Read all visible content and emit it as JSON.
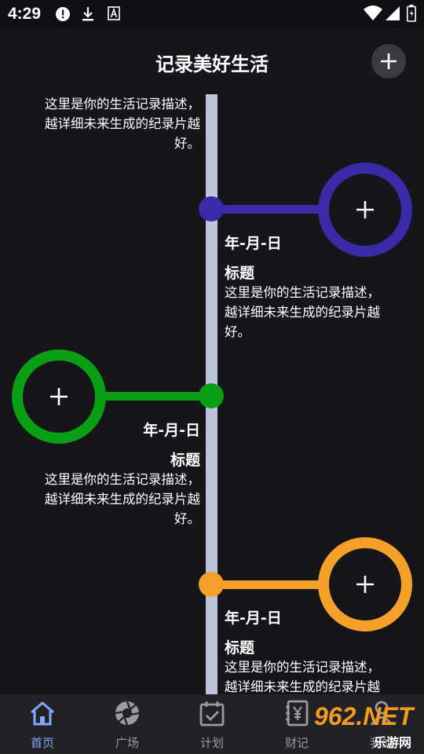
{
  "status": {
    "time": "4:29"
  },
  "header": {
    "title": "记录美好生活"
  },
  "intro_desc": [
    "这里是你的生活记录描述，",
    "越详细未来生成的纪录片越",
    "好。"
  ],
  "entries": [
    {
      "color": "#3a2aa8",
      "date": "年-月-日",
      "title": "标题",
      "desc": [
        "这里是你的生活记录描述，",
        "越详细未来生成的纪录片越",
        "好。"
      ]
    },
    {
      "color": "#0a9e14",
      "date": "年-月-日",
      "title": "标题",
      "desc": [
        "这里是你的生活记录描述，",
        "越详细未来生成的纪录片越",
        "好。"
      ]
    },
    {
      "color": "#f5a028",
      "date": "年-月-日",
      "title": "标题",
      "desc": [
        "这里是你的生活记录描述，",
        "越详细未来生成的纪录片越"
      ]
    }
  ],
  "nav": {
    "items": [
      {
        "label": "首页",
        "icon": "home-icon"
      },
      {
        "label": "广场",
        "icon": "aperture-icon"
      },
      {
        "label": "计划",
        "icon": "calendar-check-icon"
      },
      {
        "label": "财记",
        "icon": "yen-notebook-icon"
      },
      {
        "label": "我的",
        "icon": "person-icon"
      }
    ]
  },
  "watermark": {
    "number": "962.NET",
    "site": "乐游网"
  }
}
